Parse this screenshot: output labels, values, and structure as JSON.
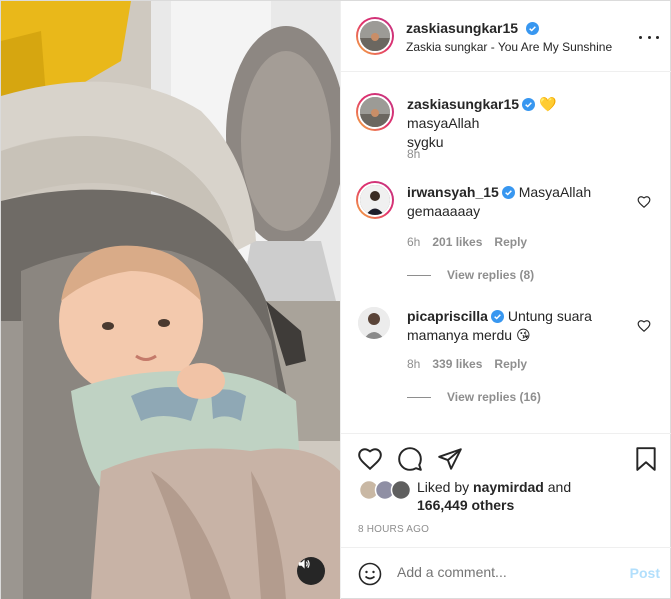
{
  "header": {
    "username": "zaskiasungkar15",
    "audio": "Zaskia sungkar - You Are My Sunshine"
  },
  "caption": {
    "username": "zaskiasungkar15",
    "emoji": "💛",
    "text_line1": "masyaAllah",
    "text_line2": "sygku",
    "time": "8h"
  },
  "comments": [
    {
      "username": "irwansyah_15",
      "line1": "MasyaAllah",
      "line2": "gemaaaaay",
      "time": "6h",
      "likes": "201 likes",
      "reply": "Reply",
      "view_replies": "View replies (8)"
    },
    {
      "username": "picapriscilla",
      "line1": "Untung suara",
      "line2": "mamanya merdu",
      "emoji": "😘",
      "time": "8h",
      "likes": "339 likes",
      "reply": "Reply",
      "view_replies": "View replies (16)"
    }
  ],
  "likes": {
    "prefix": "Liked by",
    "user": "naymirdad",
    "conj": "and",
    "others": "166,449 others"
  },
  "post_time": "8 HOURS AGO",
  "comment_box": {
    "placeholder": "Add a comment...",
    "post_label": "Post"
  },
  "icons": {
    "like": "heart-icon",
    "comment": "comment-icon",
    "share": "paper-plane-icon",
    "save": "bookmark-icon",
    "emoji": "smiley-icon",
    "options": "more-options-icon",
    "audio": "speaker-icon"
  },
  "colors": {
    "verified": "#3897f0",
    "post_button": "#b2dffc",
    "muted_text": "#8e8e8e"
  }
}
